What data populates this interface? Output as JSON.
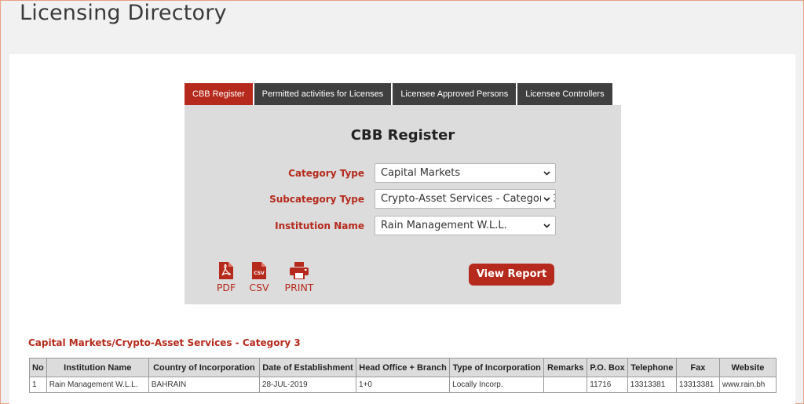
{
  "page": {
    "title": "Licensing Directory"
  },
  "tabs": [
    {
      "label": "CBB Register",
      "active": true
    },
    {
      "label": "Permitted activities for Licenses",
      "active": false
    },
    {
      "label": "Licensee Approved Persons",
      "active": false
    },
    {
      "label": "Licensee Controllers",
      "active": false
    }
  ],
  "form": {
    "heading": "CBB Register",
    "fields": [
      {
        "label": "Category Type",
        "value": "Capital Markets"
      },
      {
        "label": "Subcategory Type",
        "value": "Crypto-Asset Services - Category 3"
      },
      {
        "label": "Institution Name",
        "value": "Rain Management W.L.L."
      }
    ],
    "exports": [
      {
        "label": "PDF",
        "icon": "pdf-file-icon"
      },
      {
        "label": "CSV",
        "icon": "csv-file-icon"
      },
      {
        "label": "PRINT",
        "icon": "printer-icon"
      }
    ],
    "view_button": "View Report"
  },
  "results": {
    "title": "Capital Markets/Crypto-Asset Services - Category 3",
    "columns": [
      "No",
      "Institution Name",
      "Country of Incorporation",
      "Date of Establishment",
      "Head Office + Branch",
      "Type of Incorporation",
      "Remarks",
      "P.O. Box",
      "Telephone",
      "Fax",
      "Website"
    ],
    "rows": [
      [
        "1",
        "Rain Management W.L.L.",
        "BAHRAIN",
        "28-JUL-2019",
        "1+0",
        "Locally Incorp.",
        "",
        "11716",
        "13313381",
        "13313381",
        "www.rain.bh"
      ]
    ]
  },
  "colors": {
    "accent": "#b52a1c",
    "tab_dark": "#3f3f3f",
    "form_bg": "#dcdcdc"
  }
}
